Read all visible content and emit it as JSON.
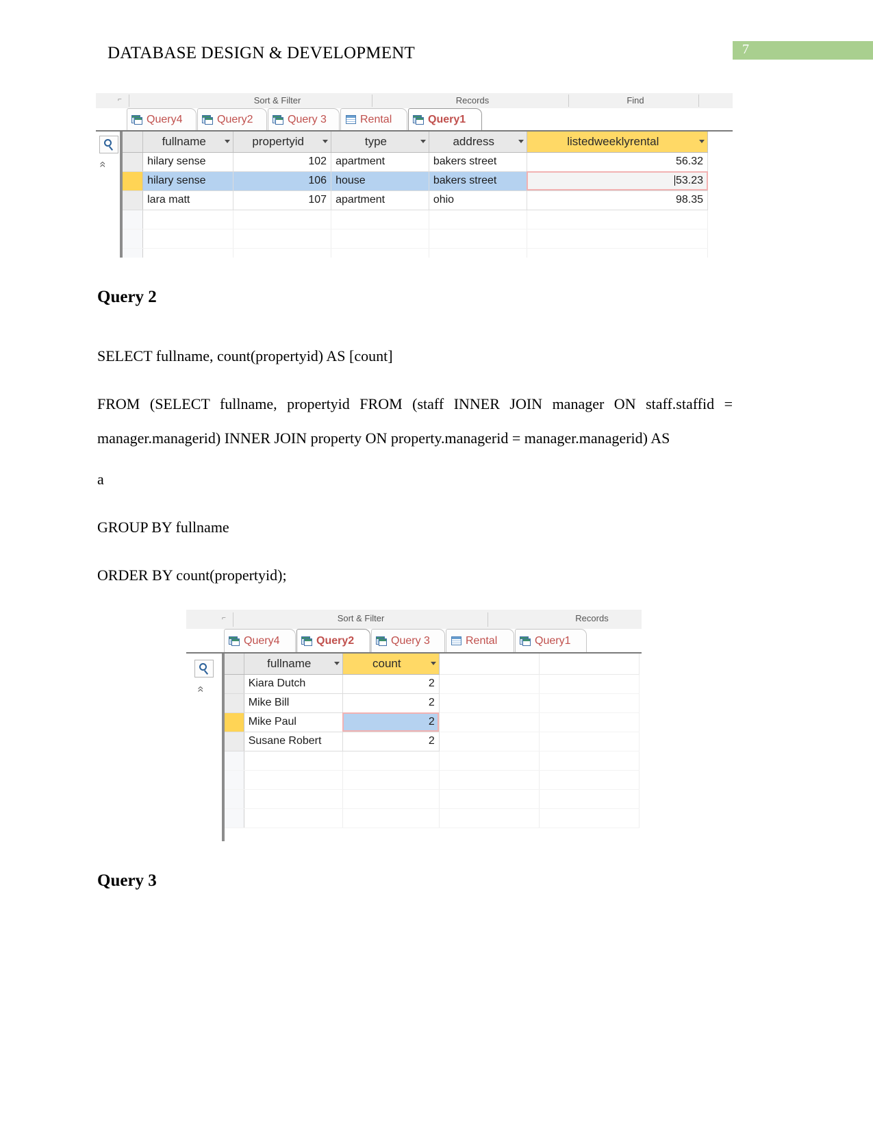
{
  "document": {
    "header_title": "DATABASE DESIGN & DEVELOPMENT",
    "page_number": "7",
    "badge_color": "#a9cf8f"
  },
  "screenshot_1": {
    "ribbon": {
      "groups": [
        "Sort & Filter",
        "Records",
        "Find"
      ],
      "launcher_glyph": "⌐"
    },
    "rail": {
      "collapse_glyph": "«",
      "chevrons_glyph": "«",
      "search_icon": "search-icon"
    },
    "tabs": [
      {
        "label": "Query4",
        "icon": "query-icon",
        "active": false
      },
      {
        "label": "Query2",
        "icon": "query-icon",
        "active": false
      },
      {
        "label": "Query 3",
        "icon": "query-icon",
        "active": false
      },
      {
        "label": "Rental",
        "icon": "table-icon",
        "active": false
      },
      {
        "label": "Query1",
        "icon": "query-icon",
        "active": true
      }
    ],
    "grid": {
      "columns": [
        "fullname",
        "propertyid",
        "type",
        "address",
        "listedweeklyrental"
      ],
      "highlight_column": "listedweeklyrental",
      "rows": [
        {
          "fullname": "hilary sense",
          "propertyid": "102",
          "type": "apartment",
          "address": "bakers street",
          "listedweeklyrental": "56.32",
          "selected": false,
          "focus": false
        },
        {
          "fullname": "hilary sense",
          "propertyid": "106",
          "type": "house",
          "address": "bakers street",
          "listedweeklyrental": "53.23",
          "selected": true,
          "focus": true
        },
        {
          "fullname": "lara matt",
          "propertyid": "107",
          "type": "apartment",
          "address": "ohio",
          "listedweeklyrental": "98.35",
          "selected": false,
          "focus": false
        }
      ]
    }
  },
  "query2": {
    "heading": "Query 2",
    "lines": [
      "SELECT fullname, count(propertyid) AS [count]",
      "FROM (SELECT fullname, propertyid FROM (staff INNER JOIN manager ON staff.staffid = manager.managerid) INNER JOIN property ON property.managerid = manager.managerid)   AS a",
      "GROUP BY fullname",
      "ORDER BY count(propertyid);"
    ],
    "line1": "SELECT fullname, count(propertyid) AS [count]",
    "line2": "FROM (SELECT fullname, propertyid FROM (staff INNER JOIN manager ON staff.staffid = manager.managerid) INNER JOIN property ON property.managerid = manager.managerid)   AS",
    "line3": "a",
    "line4": "GROUP BY fullname",
    "line5": "ORDER BY count(propertyid);"
  },
  "screenshot_2": {
    "ribbon": {
      "groups": [
        "Sort & Filter",
        "Records"
      ],
      "launcher_glyph": "⌐"
    },
    "rail": {
      "undo_glyph": "⊙",
      "collapse_glyph": "«",
      "chevrons_glyph": "«",
      "search_icon": "search-icon"
    },
    "tabs": [
      {
        "label": "Query4",
        "icon": "query-icon",
        "active": false
      },
      {
        "label": "Query2",
        "icon": "query-icon",
        "active": true
      },
      {
        "label": "Query 3",
        "icon": "query-icon",
        "active": false
      },
      {
        "label": "Rental",
        "icon": "table-icon",
        "active": false
      },
      {
        "label": "Query1",
        "icon": "query-icon",
        "active": false
      }
    ],
    "grid": {
      "columns": [
        "fullname",
        "count"
      ],
      "highlight_column": "count",
      "rows": [
        {
          "fullname": "Kiara Dutch",
          "count": "2",
          "selected": false,
          "focus": false
        },
        {
          "fullname": "Mike Bill",
          "count": "2",
          "selected": false,
          "focus": false
        },
        {
          "fullname": "Mike Paul",
          "count": "2",
          "selected": true,
          "focus": true
        },
        {
          "fullname": "Susane Robert",
          "count": "2",
          "selected": false,
          "focus": false
        }
      ]
    }
  },
  "query3": {
    "heading": "Query 3"
  }
}
